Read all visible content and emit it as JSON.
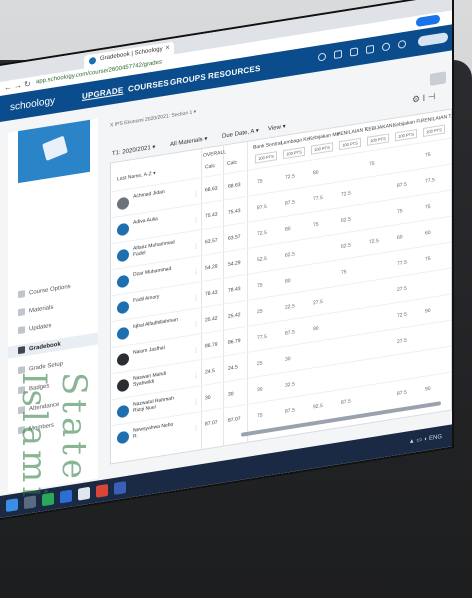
{
  "browser": {
    "tab_title": "Gradebook | Schoology",
    "url": "app.schoology.com/course/2600457742/grades"
  },
  "header": {
    "logo": "schoology",
    "nav": [
      "UPGRADE",
      "COURSES",
      "GROUPS",
      "RESOURCES"
    ]
  },
  "sidebar": {
    "items": [
      {
        "label": "Course Options",
        "active": false
      },
      {
        "label": "Materials",
        "active": false
      },
      {
        "label": "Updates",
        "active": false
      },
      {
        "label": "Gradebook",
        "active": true
      },
      {
        "label": "Grade Setup",
        "active": false
      },
      {
        "label": "Badges",
        "active": false
      },
      {
        "label": "Attendance",
        "active": false
      },
      {
        "label": "Members",
        "active": false
      }
    ]
  },
  "main": {
    "breadcrumb": "X IPS Ekonomi 2020/2021: Section 1 ▾",
    "filters": [
      "T1: 2020/2021 ▾",
      "All Materials ▾",
      "Due Date, A ▾",
      "View ▾"
    ],
    "sort_label": "Last Name, A-Z ▾",
    "overall_label": "OVERALL",
    "columns": [
      "Bank Sentral...",
      "Lembaga Ke...",
      "Kebijakan Mo...",
      "PENILAIAN T...",
      "KEBIJAKAN...",
      "Kebijakan Fi...",
      "PENILAIAN T..."
    ],
    "column_max": "100 PTS",
    "rows": [
      {
        "name": "Achmad Jidan",
        "overall": "68.63",
        "calc": "68.63",
        "avatar": "gray",
        "grades": [
          "75",
          "72.5",
          "80",
          "",
          "75",
          "",
          "75"
        ]
      },
      {
        "name": "Adiva Aulia",
        "overall": "75.43",
        "calc": "75.43",
        "avatar": "blue",
        "grades": [
          "87.5",
          "87.5",
          "77.5",
          "72.5",
          "",
          "87.5",
          "77.5"
        ]
      },
      {
        "name": "Alfariz Muhammad Fadel",
        "overall": "63.57",
        "calc": "63.57",
        "avatar": "blue",
        "grades": [
          "72.5",
          "80",
          "75",
          "62.5",
          "",
          "75",
          "75"
        ]
      },
      {
        "name": "Dzar Muhammad",
        "overall": "54.29",
        "calc": "54.29",
        "avatar": "blue",
        "grades": [
          "52.5",
          "62.5",
          "",
          "62.5",
          "72.5",
          "60",
          "60"
        ]
      },
      {
        "name": "Fadil Amory",
        "overall": "78.43",
        "calc": "78.43",
        "avatar": "blue",
        "grades": [
          "75",
          "80",
          "",
          "75",
          "",
          "77.5",
          "75"
        ]
      },
      {
        "name": "Iqbal Alfadhillahman",
        "overall": "25.42",
        "calc": "25.42",
        "avatar": "blue",
        "grades": [
          "25",
          "22.5",
          "27.5",
          "",
          "",
          "27.5",
          ""
        ]
      },
      {
        "name": "Naiom Jasfhal",
        "overall": "86.79",
        "calc": "86.79",
        "avatar": "dark",
        "grades": [
          "77.5",
          "87.5",
          "90",
          "",
          "",
          "72.5",
          "90"
        ]
      },
      {
        "name": "Naswan Mahdi Syahwildi",
        "overall": "24.5",
        "calc": "24.5",
        "avatar": "dark",
        "grades": [
          "25",
          "30",
          "",
          "",
          "",
          "27.5",
          ""
        ]
      },
      {
        "name": "Nazwatul Rahmah Rizqi Nuel",
        "overall": "30",
        "calc": "30",
        "avatar": "blue",
        "grades": [
          "30",
          "32.5",
          "",
          "",
          "",
          "",
          ""
        ]
      },
      {
        "name": "Newsyahwa Nebo R.",
        "overall": "87.07",
        "calc": "87.07",
        "avatar": "blue",
        "grades": [
          "75",
          "87.5",
          "92.5",
          "87.5",
          "",
          "87.5",
          "90"
        ]
      }
    ]
  },
  "watermark": "State Islami"
}
